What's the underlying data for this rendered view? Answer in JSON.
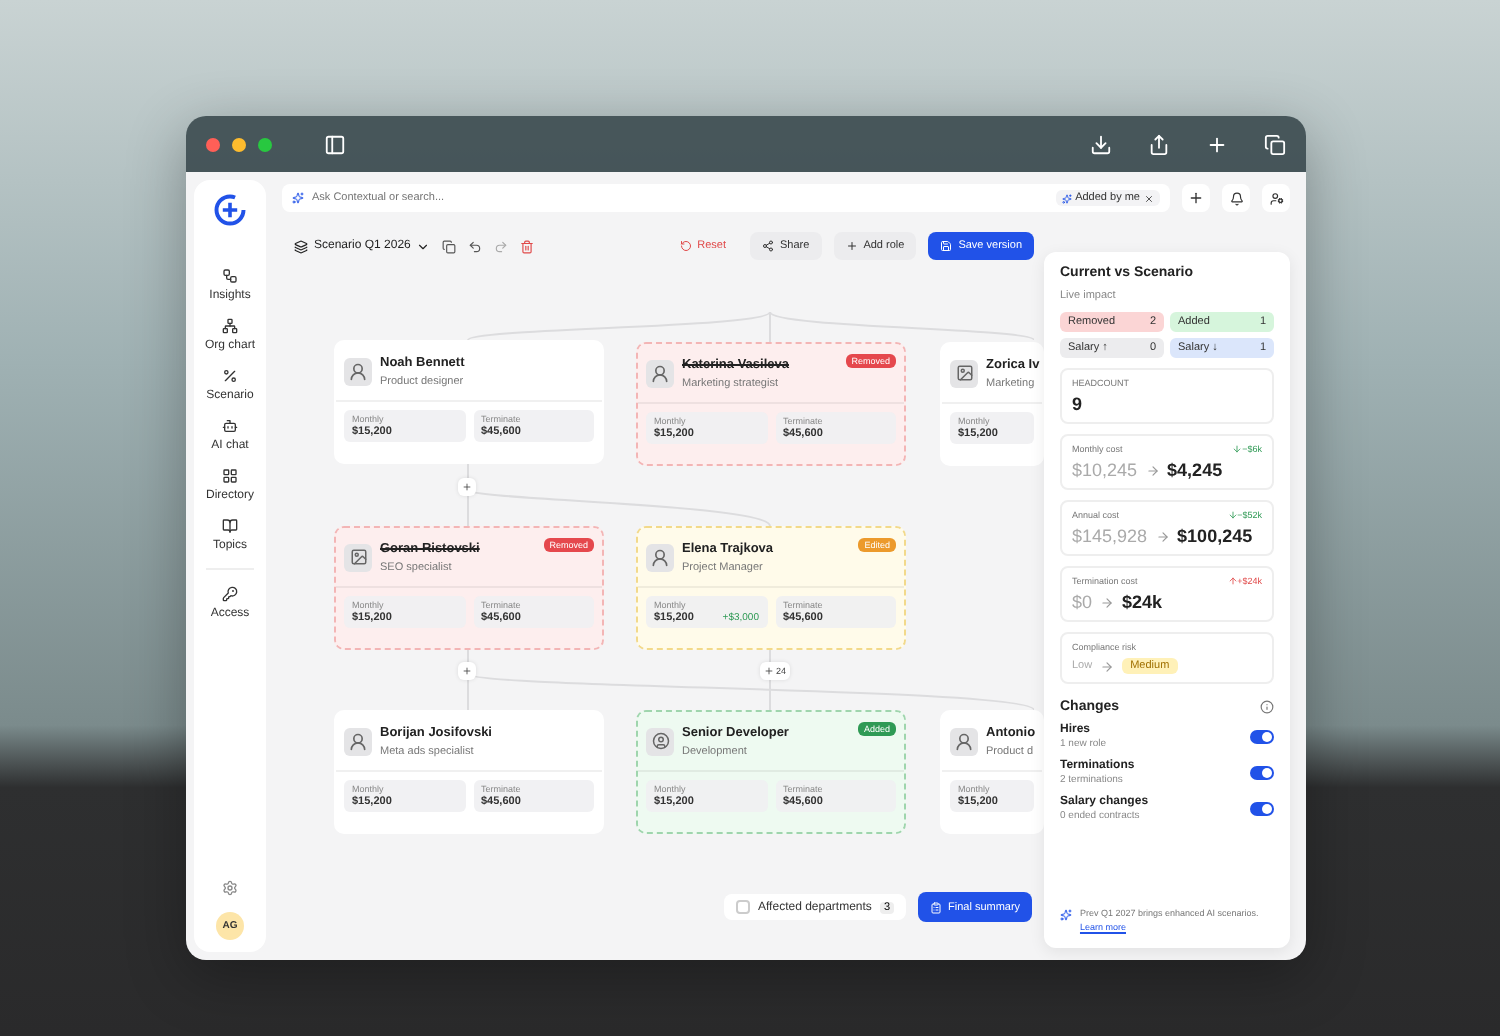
{
  "search": {
    "placeholder": "Ask Contextual or search...",
    "chip": "Added by me"
  },
  "sidebar": {
    "items": [
      {
        "label": "Insights"
      },
      {
        "label": "Org chart"
      },
      {
        "label": "Scenario"
      },
      {
        "label": "AI chat"
      },
      {
        "label": "Directory"
      },
      {
        "label": "Topics"
      }
    ],
    "extra": [
      {
        "label": "Access"
      }
    ],
    "avatar": "AG"
  },
  "toolbar": {
    "scenario": "Scenario Q1 2026",
    "buttons": [
      {
        "label": "Reset",
        "kind": "danger"
      },
      {
        "label": "Share",
        "kind": "plain"
      },
      {
        "label": "Add role",
        "kind": "plain"
      },
      {
        "label": "Save version",
        "kind": "primary"
      }
    ]
  },
  "cards": [
    {
      "name": "Noah Bennett",
      "role": "Product designer",
      "kind": "none",
      "avatar": {
        "kind": "photo"
      },
      "metrics": [
        {
          "label": "Monthly",
          "value": "$15,200"
        },
        {
          "label": "Terminate",
          "value": "$45,600"
        }
      ]
    },
    {
      "name": "Katerina Vasileva",
      "role": "Marketing strategist",
      "kind": "removed",
      "badge": "Removed",
      "avatar": {
        "kind": "photo"
      },
      "metrics": [
        {
          "label": "Monthly",
          "value": "$15,200"
        },
        {
          "label": "Terminate",
          "value": "$45,600"
        }
      ]
    },
    {
      "name": "Zorica Iv",
      "role": "Marketing",
      "kind": "none",
      "avatar": {
        "kind": "icon"
      },
      "partial": true,
      "metrics": [
        {
          "label": "Monthly",
          "value": "$15,200"
        }
      ]
    },
    {
      "name": "Goran Ristovski",
      "role": "SEO specialist",
      "kind": "removed",
      "badge": "Removed",
      "avatar": {
        "kind": "icon"
      },
      "metrics": [
        {
          "label": "Monthly",
          "value": "$15,200"
        },
        {
          "label": "Terminate",
          "value": "$45,600"
        }
      ]
    },
    {
      "name": "Elena Trajkova",
      "role": "Project Manager",
      "kind": "edited",
      "badge": "Edited",
      "avatar": {
        "kind": "photo"
      },
      "metrics": [
        {
          "label": "Monthly",
          "value": "$15,200",
          "delta": "+$3,000"
        },
        {
          "label": "Terminate",
          "value": "$45,600"
        }
      ]
    },
    {
      "name": "Borijan Josifovski",
      "role": "Meta ads specialist",
      "kind": "none",
      "avatar": {
        "kind": "photo"
      },
      "metrics": [
        {
          "label": "Monthly",
          "value": "$15,200"
        },
        {
          "label": "Terminate",
          "value": "$45,600"
        }
      ]
    },
    {
      "name": "Senior Developer",
      "role": "Development",
      "kind": "added",
      "badge": "Added",
      "avatar": {
        "kind": "role"
      },
      "metrics": [
        {
          "label": "Monthly",
          "value": "$15,200"
        },
        {
          "label": "Terminate",
          "value": "$45,600"
        }
      ]
    },
    {
      "name": "Antonio",
      "role": "Product d",
      "kind": "none",
      "avatar": {
        "kind": "photo"
      },
      "partial": true,
      "metrics": [
        {
          "label": "Monthly",
          "value": "$15,200"
        }
      ]
    }
  ],
  "add_buttons": [
    {
      "kind": "plain"
    },
    {
      "kind": "plain"
    },
    {
      "kind": "count",
      "count": "24"
    }
  ],
  "bottom_bar": {
    "checked": false,
    "label": "Affected departments",
    "count": "3",
    "button": "Final summary"
  },
  "panel": {
    "title": "Current vs Scenario",
    "subtitle": "Live impact",
    "chips": [
      {
        "label": "Removed",
        "count": "2",
        "color": "#fbd5d5"
      },
      {
        "label": "Added",
        "count": "1",
        "color": "#d6f5dc"
      },
      {
        "label": "Salary ↑",
        "count": "0",
        "color": "#ececee"
      },
      {
        "label": "Salary ↓",
        "count": "1",
        "color": "#dbe6fb"
      }
    ],
    "headcount": {
      "label": "HEADCOUNT",
      "value": "9"
    },
    "costs": [
      {
        "label": "Monthly cost",
        "delta": "−$6k",
        "kind": "down",
        "from": "$10,245",
        "to": "$4,245"
      },
      {
        "label": "Annual cost",
        "delta": "−$52k",
        "kind": "down",
        "from": "$145,928",
        "to": "$100,245"
      },
      {
        "label": "Termination cost",
        "delta": "+$24k",
        "kind": "up",
        "from": "$0",
        "to": "$24k"
      }
    ],
    "risk": {
      "label": "Compliance risk",
      "from": "Low",
      "to": "Medium"
    },
    "changes_title": "Changes",
    "toggles": [
      {
        "label": "Hires",
        "detail": "1 new role",
        "on": true
      },
      {
        "label": "Terminations",
        "detail": "2 terminations",
        "on": true
      },
      {
        "label": "Salary changes",
        "detail": "0 ended contracts",
        "on": true
      }
    ],
    "footer": {
      "text": "Prev Q1 2027 brings enhanced AI scenarios.",
      "link": "Learn more"
    }
  }
}
